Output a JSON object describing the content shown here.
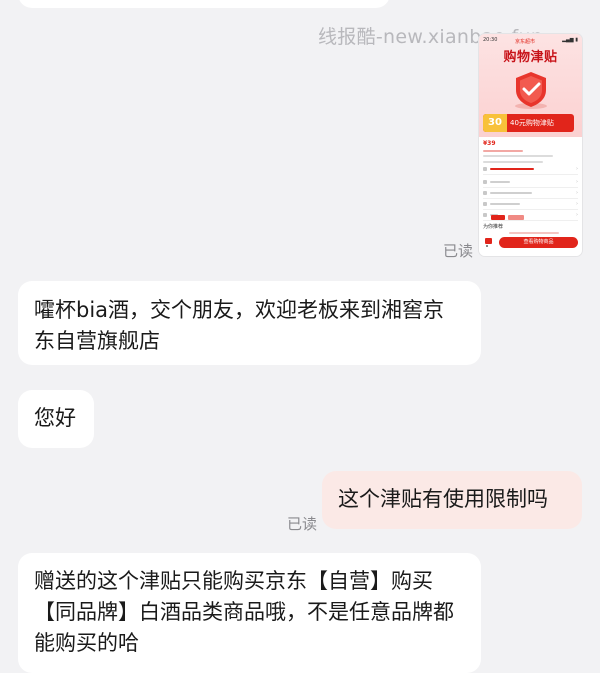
{
  "watermark": "线报酷-new.xianbao.fun",
  "read_status": "已读",
  "messages": [
    {
      "side": "left",
      "text": "嚯杯bia酒，交个朋友，欢迎老板来到湘窖京东自营旗舰店"
    },
    {
      "side": "left",
      "text": "您好"
    },
    {
      "side": "right",
      "text": "这个津贴有使用限制吗"
    },
    {
      "side": "left",
      "text": "赠送的这个津贴只能购买京东【自营】购买【同品牌】白酒品类商品哦，不是任意品牌都能购买的哈"
    }
  ],
  "screenshot": {
    "time": "20:30",
    "brand": "京东超市",
    "title": "购物津贴",
    "coupon_number": "30",
    "coupon_label": "40元购物津贴",
    "price": "¥39",
    "section_label": "为你推荐",
    "buy_button": "查看购物商品"
  },
  "colors": {
    "background": "#f2f2f4",
    "bubble_left": "#ffffff",
    "bubble_right": "#fbe9e6",
    "jd_red": "#e1251b",
    "watermark": "#b8b8bc"
  }
}
